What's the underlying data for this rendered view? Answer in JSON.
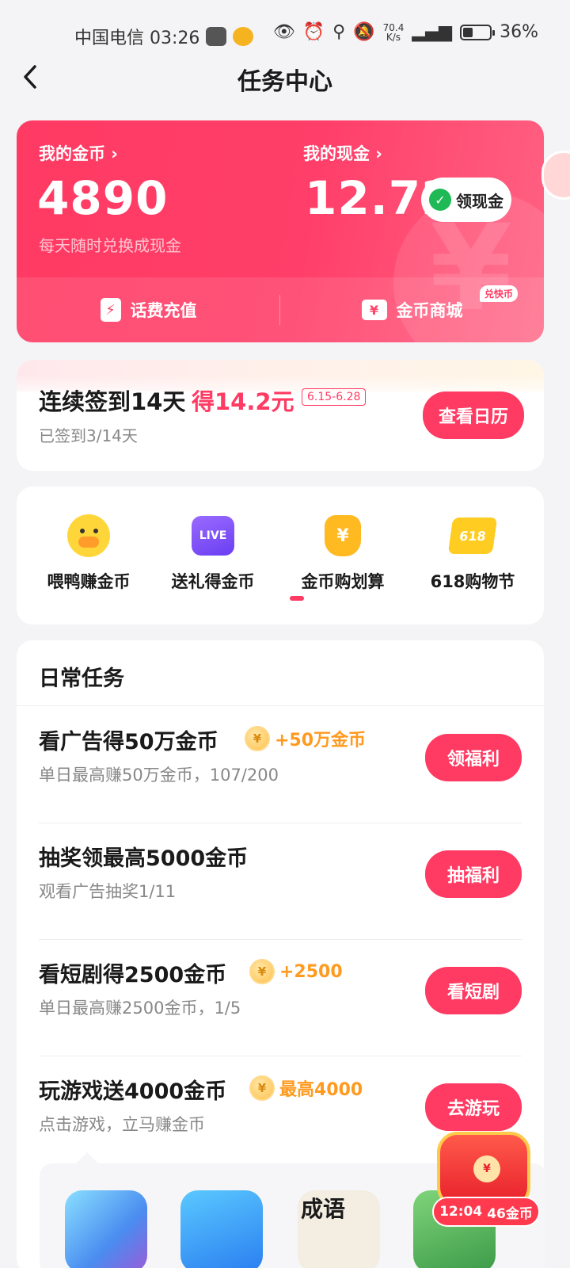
{
  "status_bar": {
    "carrier_time": "中国电信 03:26",
    "net_speed_value": "70.4",
    "net_speed_unit": "K/s",
    "battery": "36%",
    "battery_level": 0.36
  },
  "nav": {
    "title": "任务中心"
  },
  "wallet": {
    "coins_label": "我的金币 ›",
    "coins_value": "4890",
    "coins_desc": "每天随时兑换成现金",
    "cash_label": "我的现金 ›",
    "cash_value": "12.72",
    "withdraw_button": "领现金",
    "recharge_label": "话费充值",
    "mall_label": "金币商城",
    "mall_badge": "兑快币"
  },
  "signin": {
    "title": "连续签到14天",
    "reward": "得14.2元",
    "date_range": "6.15-6.28",
    "progress": "已签到3/14天",
    "button": "查看日历"
  },
  "shortcuts": [
    {
      "label": "喂鸭赚金币",
      "icon": "duck-icon"
    },
    {
      "label": "送礼得金币",
      "icon": "live-icon",
      "icon_text": "LIVE"
    },
    {
      "label": "金币购划算",
      "icon": "money-bag-icon",
      "icon_text": "¥"
    },
    {
      "label": "618购物节",
      "icon": "shopping-cart-icon",
      "icon_text": "618"
    }
  ],
  "daily": {
    "title": "日常任务",
    "tasks": [
      {
        "title": "看广告得50万金币",
        "reward": "+50万金币",
        "subtitle": "单日最高赚50万金币，107/200",
        "button": "领福利"
      },
      {
        "title": "抽奖领最高5000金币",
        "reward": "",
        "subtitle": "观看广告抽奖1/11",
        "button": "抽福利"
      },
      {
        "title": "看短剧得2500金币",
        "reward": "+2500",
        "subtitle": "单日最高赚2500金币，1/5",
        "button": "看短剧"
      },
      {
        "title": "玩游戏送4000金币",
        "reward": "最高4000",
        "subtitle": "点击游戏，立马赚金币",
        "button": "去游玩"
      }
    ]
  },
  "games": [
    {
      "icon": "game-bubble-icon",
      "color": "#6bd0ff"
    },
    {
      "icon": "game-draw-icon",
      "color": "#3aa8ff"
    },
    {
      "icon": "game-idiom-icon",
      "color": "#f3ede2",
      "text": "成语"
    },
    {
      "icon": "game-cartoon-icon",
      "color": "#6ec06a"
    }
  ],
  "floating_reward": {
    "timer": "12:04",
    "label": "46金币"
  },
  "colors": {
    "accent": "#ff3a63",
    "coin_orange": "#ff9a1f"
  }
}
